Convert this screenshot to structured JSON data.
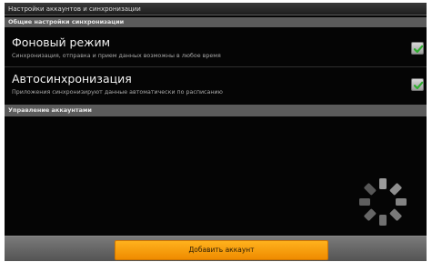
{
  "window": {
    "title": "Настройки аккаунтов и синхронизации"
  },
  "general_section": {
    "header": "Общие настройки синхронизации",
    "settings": [
      {
        "title": "Фоновый режим",
        "summary": "Синхронизация, отправка и прием данных возможны в любое время",
        "checked": true
      },
      {
        "title": "Автосинхронизация",
        "summary": "Приложения синхронизируют данные автоматически по расписанию",
        "checked": true
      }
    ]
  },
  "accounts_section": {
    "header": "Управление аккаунтами",
    "loading": true
  },
  "bottom_bar": {
    "add_account_label": "Добавить аккаунт"
  },
  "colors": {
    "background": "#050505",
    "section_header": "#5b5b5b",
    "checkmark": "#2fae2f",
    "button": "#f59c0c"
  },
  "icons": {
    "checkbox": "check-icon",
    "loading": "spinner-icon"
  }
}
